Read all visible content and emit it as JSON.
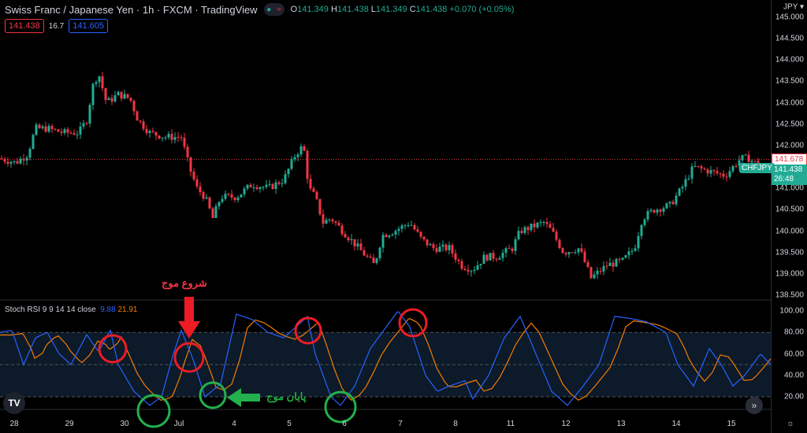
{
  "header": {
    "symbol": "Swiss Franc / Japanese Yen · 1h · FXCM · TradingView",
    "o_label": "O",
    "o": "141.349",
    "h_label": "H",
    "h": "141.438",
    "l_label": "L",
    "l": "141.349",
    "c_label": "C",
    "c": "141.438",
    "change": "+0.070 (+0.05%)"
  },
  "quote": {
    "sell": "141.438",
    "spread": "16.7",
    "buy": "141.605"
  },
  "axis": {
    "currency": "JPY ▾",
    "ticks": [
      "145.000",
      "144.500",
      "144.000",
      "143.500",
      "143.000",
      "142.500",
      "142.000",
      "141.000",
      "140.500",
      "140.000",
      "139.500",
      "139.000",
      "138.500"
    ],
    "stoch_ticks": [
      "100.00",
      "80.00",
      "60.00",
      "40.00",
      "20.00"
    ],
    "price_line": "141.678",
    "symbol_tag": "CHFJPY",
    "last_price": "141.438",
    "countdown": "26:48"
  },
  "time_labels": [
    "28",
    "29",
    "30",
    "Jul",
    "4",
    "5",
    "6",
    "7",
    "8",
    "11",
    "12",
    "13",
    "14",
    "15"
  ],
  "indicator": {
    "name": "Stoch RSI 9 9 14 14 close",
    "k": "9.88",
    "d": "21.91"
  },
  "annotations": {
    "wave_start": "شروع موج",
    "wave_end": "پایان موج"
  },
  "colors": {
    "up": "#22ab94",
    "down": "#f23645",
    "k": "#2962ff",
    "d": "#f57c00"
  },
  "chart_data": {
    "type": "candlestick",
    "price_path": [
      [
        0,
        141.7
      ],
      [
        20,
        141.6
      ],
      [
        35,
        141.8
      ],
      [
        45,
        142.4
      ],
      [
        60,
        142.4
      ],
      [
        80,
        142.3
      ],
      [
        100,
        142.3
      ],
      [
        110,
        142.6
      ],
      [
        118,
        143.4
      ],
      [
        125,
        143.7
      ],
      [
        135,
        143.0
      ],
      [
        150,
        143.2
      ],
      [
        165,
        143.1
      ],
      [
        175,
        142.6
      ],
      [
        190,
        142.3
      ],
      [
        210,
        142.2
      ],
      [
        230,
        142.2
      ],
      [
        240,
        141.5
      ],
      [
        250,
        141.0
      ],
      [
        260,
        140.8
      ],
      [
        270,
        140.3
      ],
      [
        280,
        140.8
      ],
      [
        300,
        140.8
      ],
      [
        320,
        141.1
      ],
      [
        340,
        141.0
      ],
      [
        360,
        141.2
      ],
      [
        375,
        141.8
      ],
      [
        385,
        142.0
      ],
      [
        392,
        141.0
      ],
      [
        400,
        140.8
      ],
      [
        410,
        140.2
      ],
      [
        420,
        140.3
      ],
      [
        440,
        139.9
      ],
      [
        460,
        139.5
      ],
      [
        475,
        139.2
      ],
      [
        485,
        139.9
      ],
      [
        500,
        140.0
      ],
      [
        520,
        140.2
      ],
      [
        535,
        139.8
      ],
      [
        550,
        139.6
      ],
      [
        570,
        139.6
      ],
      [
        585,
        139.2
      ],
      [
        600,
        139.1
      ],
      [
        615,
        139.4
      ],
      [
        630,
        139.4
      ],
      [
        650,
        139.6
      ],
      [
        660,
        140.0
      ],
      [
        690,
        140.2
      ],
      [
        700,
        140.0
      ],
      [
        715,
        139.5
      ],
      [
        735,
        139.6
      ],
      [
        750,
        138.9
      ],
      [
        770,
        139.2
      ],
      [
        790,
        139.3
      ],
      [
        805,
        139.6
      ],
      [
        815,
        140.3
      ],
      [
        830,
        140.5
      ],
      [
        850,
        140.6
      ],
      [
        865,
        141.0
      ],
      [
        880,
        141.5
      ],
      [
        900,
        141.4
      ],
      [
        920,
        141.3
      ],
      [
        940,
        141.7
      ],
      [
        950,
        141.7
      ],
      [
        965,
        141.5
      ],
      [
        978,
        141.4
      ]
    ],
    "stoch_k": [
      [
        0,
        80
      ],
      [
        15,
        82
      ],
      [
        30,
        50
      ],
      [
        45,
        75
      ],
      [
        60,
        80
      ],
      [
        75,
        60
      ],
      [
        90,
        50
      ],
      [
        110,
        78
      ],
      [
        125,
        62
      ],
      [
        140,
        82
      ],
      [
        150,
        50
      ],
      [
        170,
        25
      ],
      [
        190,
        12
      ],
      [
        205,
        20
      ],
      [
        220,
        60
      ],
      [
        230,
        82
      ],
      [
        245,
        55
      ],
      [
        260,
        20
      ],
      [
        280,
        32
      ],
      [
        300,
        97
      ],
      [
        320,
        92
      ],
      [
        340,
        80
      ],
      [
        360,
        75
      ],
      [
        380,
        88
      ],
      [
        390,
        95
      ],
      [
        400,
        60
      ],
      [
        420,
        20
      ],
      [
        432,
        12
      ],
      [
        450,
        30
      ],
      [
        470,
        65
      ],
      [
        490,
        85
      ],
      [
        505,
        100
      ],
      [
        520,
        85
      ],
      [
        540,
        40
      ],
      [
        555,
        25
      ],
      [
        570,
        30
      ],
      [
        590,
        35
      ],
      [
        600,
        18
      ],
      [
        620,
        40
      ],
      [
        640,
        75
      ],
      [
        660,
        95
      ],
      [
        680,
        60
      ],
      [
        700,
        25
      ],
      [
        720,
        12
      ],
      [
        740,
        30
      ],
      [
        760,
        50
      ],
      [
        780,
        95
      ],
      [
        800,
        93
      ],
      [
        820,
        90
      ],
      [
        845,
        80
      ],
      [
        860,
        50
      ],
      [
        880,
        30
      ],
      [
        900,
        65
      ],
      [
        915,
        50
      ],
      [
        930,
        30
      ],
      [
        945,
        40
      ],
      [
        965,
        60
      ],
      [
        978,
        50
      ]
    ]
  }
}
